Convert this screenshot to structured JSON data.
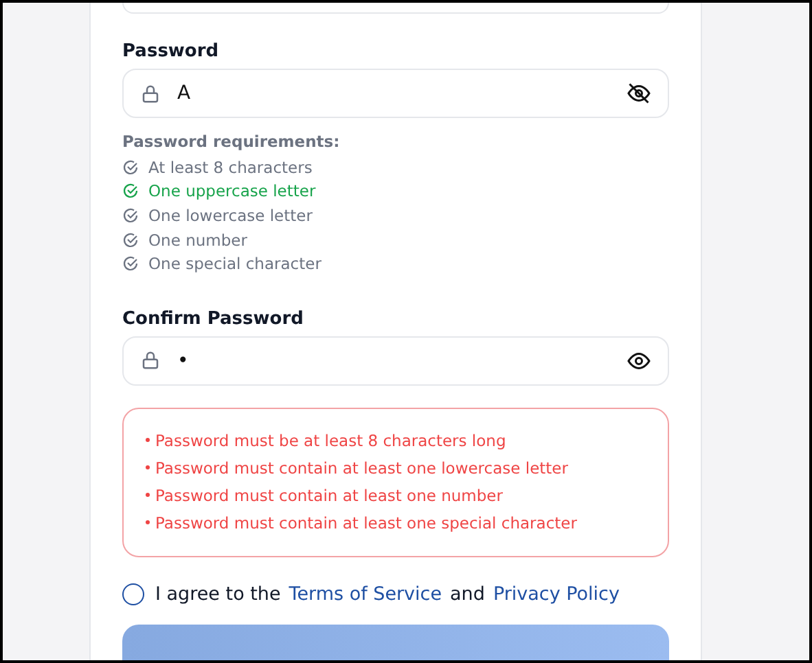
{
  "password": {
    "label": "Password",
    "value": "A",
    "visible": true
  },
  "requirements": {
    "heading": "Password requirements:",
    "items": [
      {
        "text": "At least 8 characters",
        "met": false
      },
      {
        "text": "One uppercase letter",
        "met": true
      },
      {
        "text": "One lowercase letter",
        "met": false
      },
      {
        "text": "One number",
        "met": false
      },
      {
        "text": "One special character",
        "met": false
      }
    ]
  },
  "confirm": {
    "label": "Confirm Password",
    "value": "•",
    "visible": false
  },
  "errors": [
    "Password must be at least 8 characters long",
    "Password must contain at least one lowercase letter",
    "Password must contain at least one number",
    "Password must contain at least one special character"
  ],
  "agree": {
    "checked": false,
    "parts": [
      {
        "kind": "text",
        "text": "I agree to the"
      },
      {
        "kind": "link",
        "text": "Terms of Service"
      },
      {
        "kind": "text",
        "text": "and"
      },
      {
        "kind": "link",
        "text": "Privacy Policy"
      }
    ]
  }
}
